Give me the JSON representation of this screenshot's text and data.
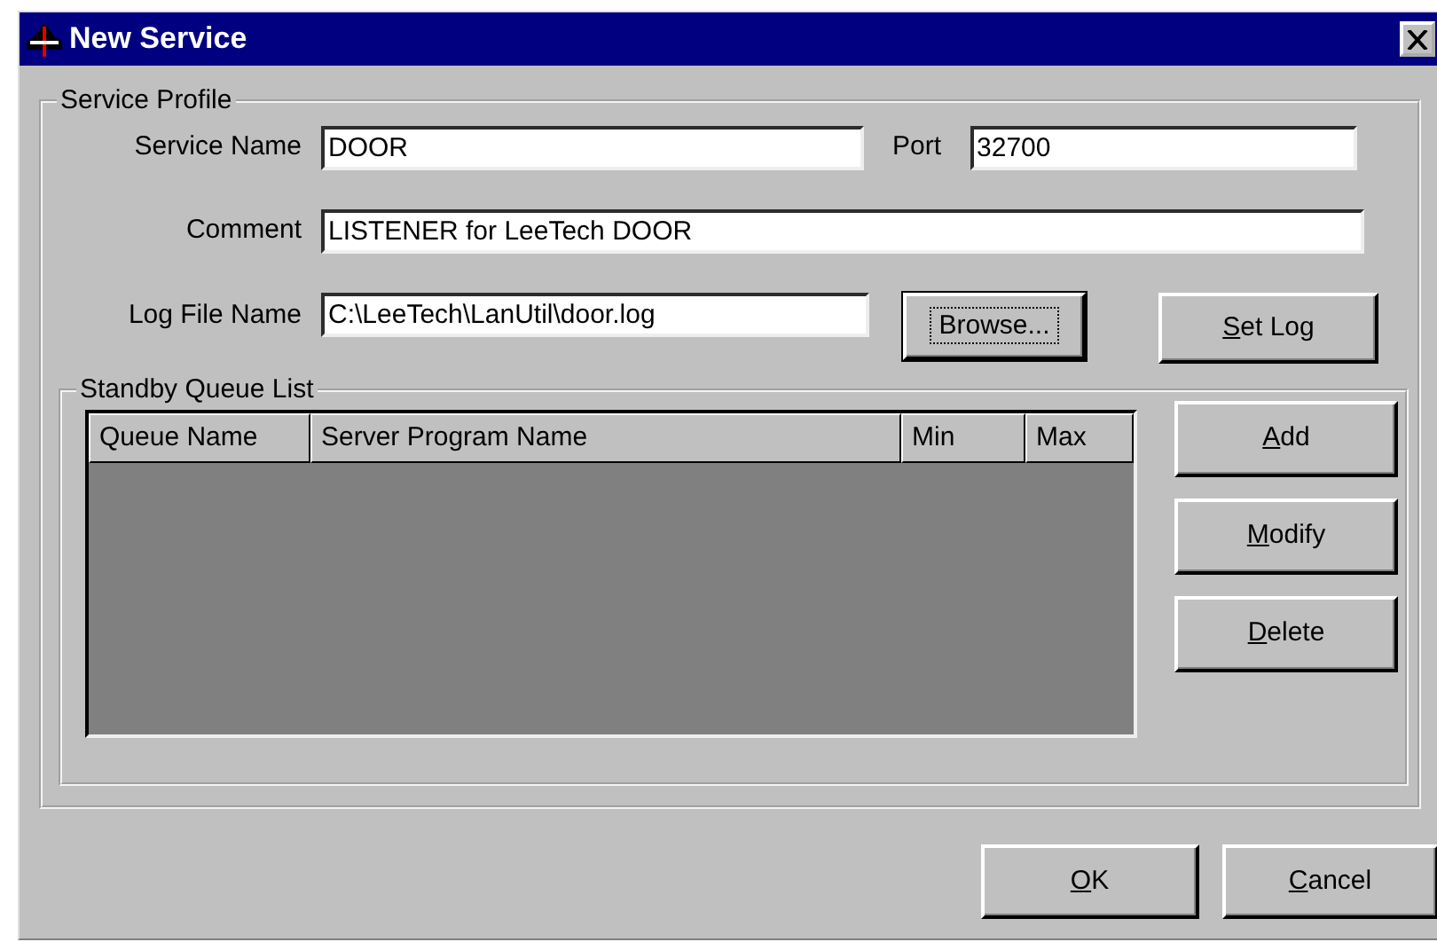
{
  "window": {
    "title": "New Service"
  },
  "service_profile": {
    "title": "Service Profile",
    "service_name": {
      "label": "Service Name",
      "value": "DOOR"
    },
    "port": {
      "label": "Port",
      "value": "32700"
    },
    "comment": {
      "label": "Comment",
      "value": "LISTENER for LeeTech DOOR"
    },
    "log_file_name": {
      "label": "Log File Name",
      "value": "C:\\LeeTech\\LanUtil\\door.log"
    },
    "browse_button": {
      "label": "Browse...",
      "mnemonic": false,
      "focused": true
    },
    "set_log_button": {
      "label": "Set Log",
      "mnemonic": true,
      "focused": false
    }
  },
  "standby_queue_list": {
    "title": "Standby Queue List",
    "columns": [
      "Queue Name",
      "Server Program Name",
      "Min",
      "Max"
    ],
    "buttons": [
      {
        "label": "Add",
        "mnemonic": true,
        "focused": false
      },
      {
        "label": "Modify",
        "mnemonic": true,
        "focused": false
      },
      {
        "label": "Delete",
        "mnemonic": true,
        "focused": false
      }
    ]
  },
  "buttons": [
    {
      "label": "OK",
      "mnemonic": true,
      "focused": false
    },
    {
      "label": "Cancel",
      "mnemonic": true,
      "focused": false
    }
  ]
}
